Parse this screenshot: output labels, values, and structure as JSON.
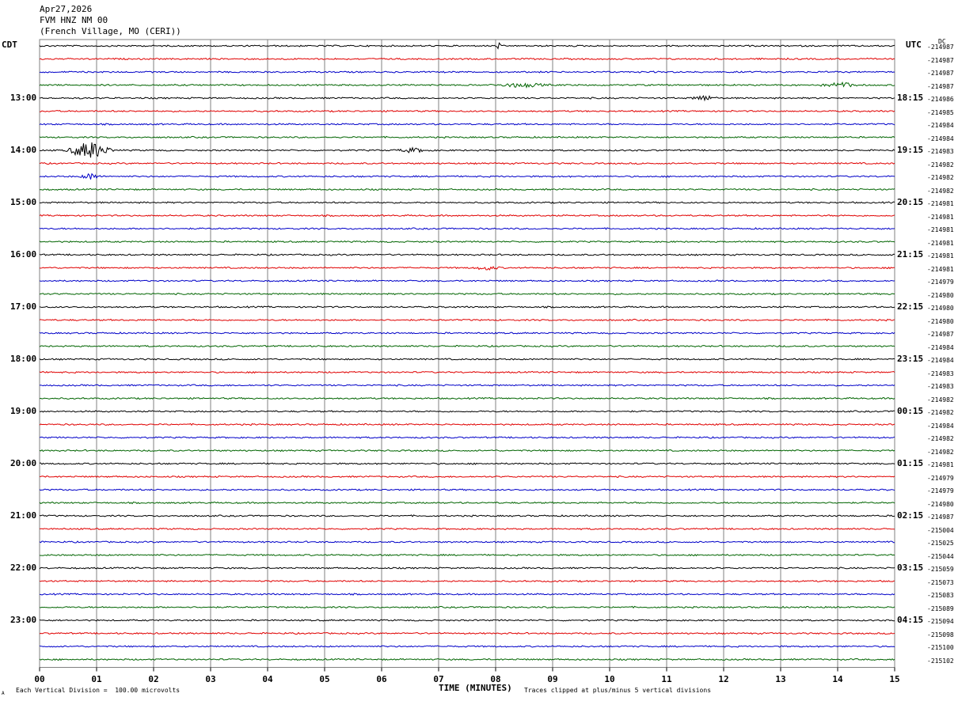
{
  "header": {
    "date": "Apr27,2026",
    "station": "FVM HNZ NM 00",
    "location": "(French Village, MO (CERI))"
  },
  "left_tz": "CDT",
  "right_tz": "UTC",
  "dc_header": "DC",
  "footer": {
    "left": "Each Vertical Division =  100.00 microvolts",
    "xlabel": "TIME (MINUTES)",
    "right": "Traces clipped at plus/minus 5 vertical divisions",
    "mark": "A"
  },
  "chart_data": {
    "type": "line",
    "subtype": "helicorder",
    "x_ticks": [
      "00",
      "01",
      "02",
      "03",
      "04",
      "05",
      "06",
      "07",
      "08",
      "09",
      "10",
      "11",
      "12",
      "13",
      "14",
      "15"
    ],
    "xlim": [
      0,
      15
    ],
    "xlabel": "TIME (MINUTES)",
    "left_hour_labels": [
      "13:00",
      "14:00",
      "15:00",
      "16:00",
      "17:00",
      "18:00",
      "19:00",
      "20:00",
      "21:00",
      "22:00",
      "23:00"
    ],
    "right_hour_labels": [
      "18:15",
      "19:15",
      "20:15",
      "21:15",
      "22:15",
      "23:15",
      "00:15",
      "01:15",
      "02:15",
      "03:15",
      "04:15"
    ],
    "trace_colors": [
      "#000000",
      "#e00000",
      "#0000c8",
      "#006400"
    ],
    "grid_color": "#808080",
    "dc_offsets": [
      "-214987",
      "-214987",
      "-214987",
      "-214987",
      "-214986",
      "-214985",
      "-214984",
      "-214984",
      "-214983",
      "-214982",
      "-214982",
      "-214982",
      "-214981",
      "-214981",
      "-214981",
      "-214981",
      "-214981",
      "-214981",
      "-214979",
      "-214980",
      "-214980",
      "-214980",
      "-214987",
      "-214984",
      "-214984",
      "-214983",
      "-214983",
      "-214982",
      "-214982",
      "-214984",
      "-214982",
      "-214982",
      "-214981",
      "-214979",
      "-214979",
      "-214980",
      "-214987",
      "-215004",
      "-215025",
      "-215044",
      "-215059",
      "-215073",
      "-215083",
      "-215089",
      "-215094",
      "-215098",
      "-215100",
      "-215102"
    ],
    "events": [
      {
        "trace": 0,
        "start_min": 8.0,
        "end_min": 8.1,
        "amp_div": 0.25
      },
      {
        "trace": 3,
        "start_min": 7.9,
        "end_min": 9.0,
        "amp_div": 0.15
      },
      {
        "trace": 3,
        "start_min": 13.7,
        "end_min": 14.4,
        "amp_div": 0.2
      },
      {
        "trace": 4,
        "start_min": 11.4,
        "end_min": 11.9,
        "amp_div": 0.2
      },
      {
        "trace": 8,
        "start_min": 0.45,
        "end_min": 1.3,
        "amp_div": 0.7
      },
      {
        "trace": 8,
        "start_min": 6.2,
        "end_min": 6.9,
        "amp_div": 0.15
      },
      {
        "trace": 10,
        "start_min": 0.7,
        "end_min": 1.1,
        "amp_div": 0.25
      },
      {
        "trace": 17,
        "start_min": 7.6,
        "end_min": 8.1,
        "amp_div": 0.15
      }
    ]
  }
}
